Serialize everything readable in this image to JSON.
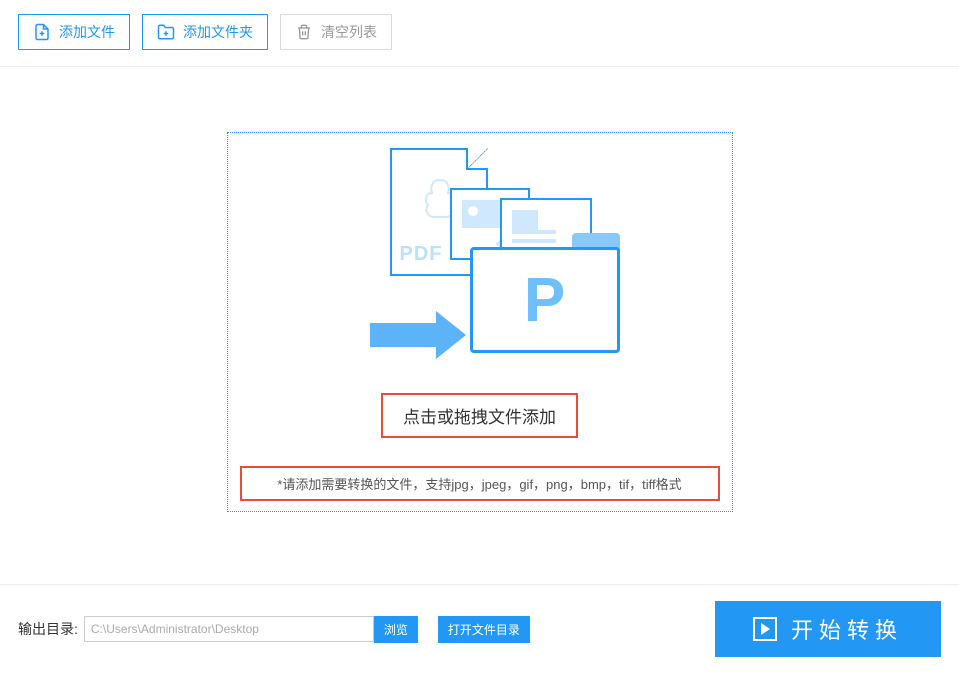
{
  "toolbar": {
    "add_file": "添加文件",
    "add_folder": "添加文件夹",
    "clear_list": "清空列表"
  },
  "drop": {
    "label": "点击或拖拽文件添加",
    "hint": "*请添加需要转换的文件，支持jpg，jpeg，gif，png，bmp，tif，tiff格式"
  },
  "footer": {
    "output_label": "输出目录:",
    "output_path": "C:\\Users\\Administrator\\Desktop",
    "browse": "浏览",
    "open_dir": "打开文件目录",
    "start": "开始转换"
  },
  "illus": {
    "pdf_text": "PDF"
  }
}
